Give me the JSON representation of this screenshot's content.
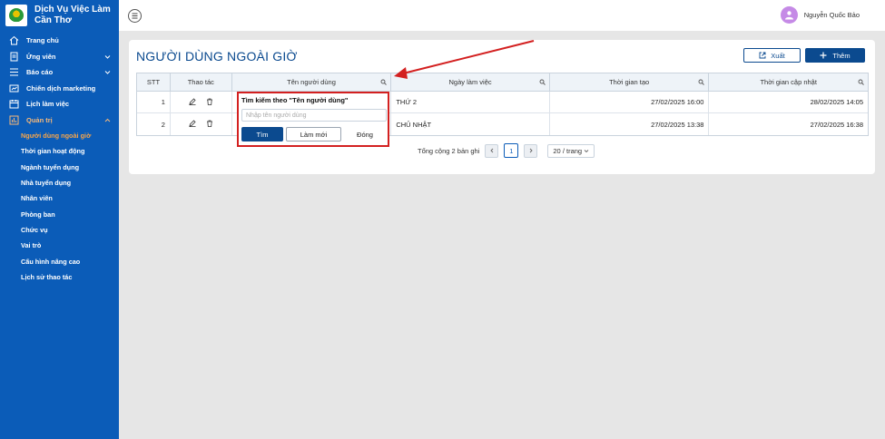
{
  "brand": {
    "line1": "Dịch Vụ Việc Làm",
    "line2": "Cần Thơ"
  },
  "sidebar": {
    "items": [
      {
        "label": "Trang chủ",
        "icon": "home-icon"
      },
      {
        "label": "Ứng viên",
        "icon": "document-icon",
        "chevron": "down"
      },
      {
        "label": "Báo cáo",
        "icon": "list-icon",
        "chevron": "down"
      },
      {
        "label": "Chiến dịch marketing",
        "icon": "campaign-icon"
      },
      {
        "label": "Lịch làm việc",
        "icon": "calendar-icon"
      },
      {
        "label": "Quản trị",
        "icon": "admin-icon",
        "chevron": "up"
      }
    ],
    "sub_items": [
      "Người dùng ngoài giờ",
      "Thời gian hoạt động",
      "Ngành tuyển dụng",
      "Nhà tuyển dụng",
      "Nhân viên",
      "Phòng ban",
      "Chức vụ",
      "Vai trò",
      "Cấu hình nâng cao",
      "Lịch sử thao tác"
    ]
  },
  "header": {
    "user_name": "Nguyễn Quốc Bảo"
  },
  "page": {
    "title": "NGƯỜI DÙNG NGOÀI GIỜ",
    "export_label": "Xuất",
    "add_label": "Thêm"
  },
  "table": {
    "headers": [
      "STT",
      "Thao tác",
      "Tên người dùng",
      "Ngày làm việc",
      "Thời gian tạo",
      "Thời gian cập nhật"
    ],
    "rows": [
      {
        "stt": "1",
        "name": "",
        "day": "THỨ 2",
        "created": "27/02/2025 16:00",
        "updated": "28/02/2025 14:05"
      },
      {
        "stt": "2",
        "name": "",
        "day": "CHỦ NHẬT",
        "created": "27/02/2025 13:38",
        "updated": "27/02/2025 16:38"
      }
    ]
  },
  "pagination": {
    "total": "Tổng cộng 2 bản ghi",
    "current": "1",
    "page_size": "20 / trang"
  },
  "search_popup": {
    "title": "Tìm kiếm theo \"Tên người dùng\"",
    "placeholder": "Nhập tên người dùng",
    "search_label": "Tìm",
    "reset_label": "Làm mới",
    "close_label": "Đóng"
  },
  "colors": {
    "sidebar": "#0b5cb8",
    "primary": "#0b4a8f",
    "active": "#f7a54a",
    "highlight": "#d32020"
  }
}
